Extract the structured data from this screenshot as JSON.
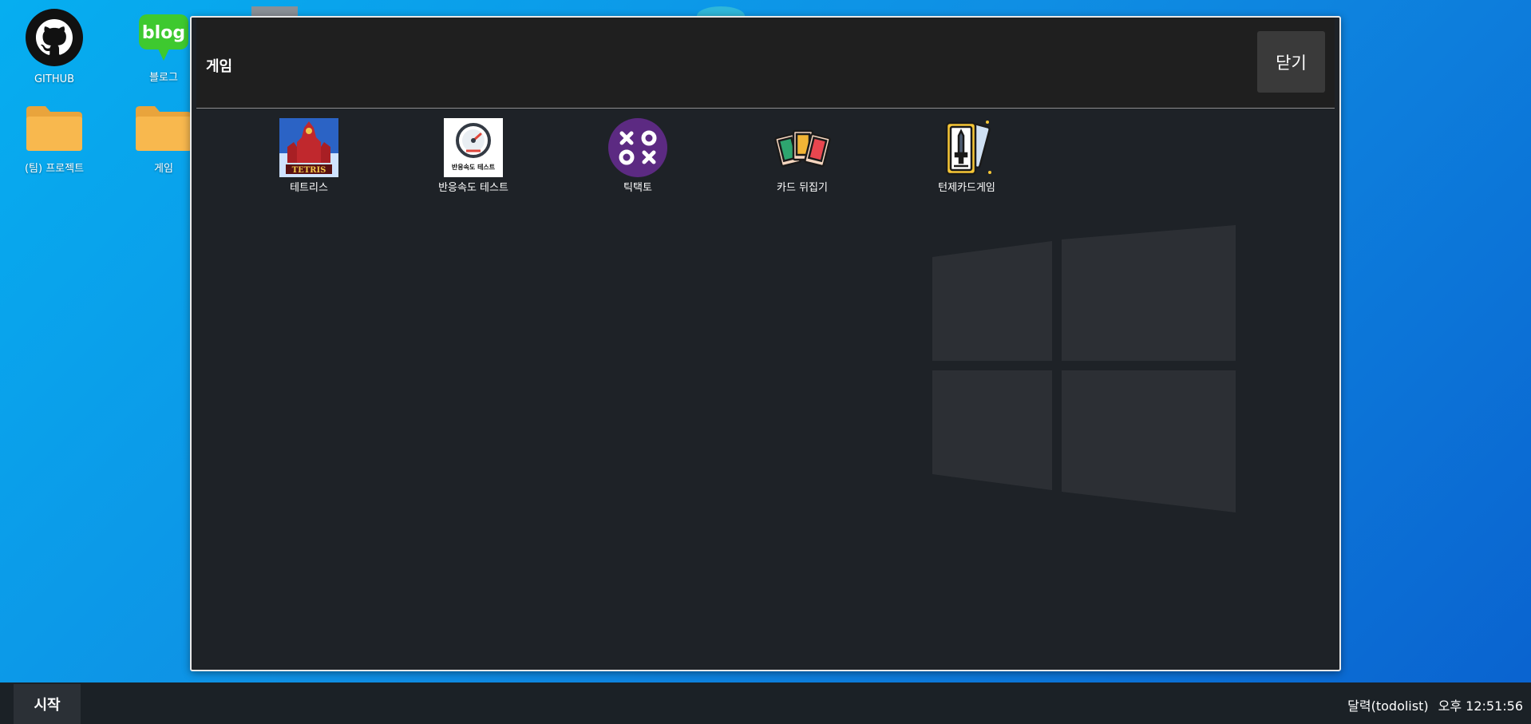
{
  "desktop": {
    "icons": [
      {
        "label": "GITHUB",
        "icon": "github-icon"
      },
      {
        "label": "블로그",
        "icon": "blog-icon"
      },
      {
        "label": "(팀) 프로젝트",
        "icon": "folder-icon"
      },
      {
        "label": "게임",
        "icon": "folder-icon"
      }
    ]
  },
  "window": {
    "title": "게임",
    "close_label": "닫기",
    "apps": [
      {
        "label": "테트리스",
        "icon": "tetris-icon",
        "icon_text": "TETRIS"
      },
      {
        "label": "반응속도 테스트",
        "icon": "speedometer-icon",
        "icon_text": "반응속도 테스트"
      },
      {
        "label": "틱택토",
        "icon": "tictactoe-icon",
        "icon_text": "XO OX"
      },
      {
        "label": "카드 뒤집기",
        "icon": "cards-icon"
      },
      {
        "label": "턴제카드게임",
        "icon": "sword-card-icon"
      }
    ]
  },
  "taskbar": {
    "start_label": "시작",
    "calendar_label": "달력(todolist)",
    "clock": "오후 12:51:56"
  },
  "colors": {
    "desktop_top": "#06aef0",
    "desktop_bottom": "#0a62cf",
    "window_bg": "#1e2227",
    "header_bg": "#1f1f1f",
    "close_button_bg": "#3a3a3a",
    "taskbar_bg": "#1b2126",
    "blog_green": "#3ec92f",
    "folder_yellow": "#f8b84e",
    "tictactoe_purple": "#5c2a82"
  }
}
